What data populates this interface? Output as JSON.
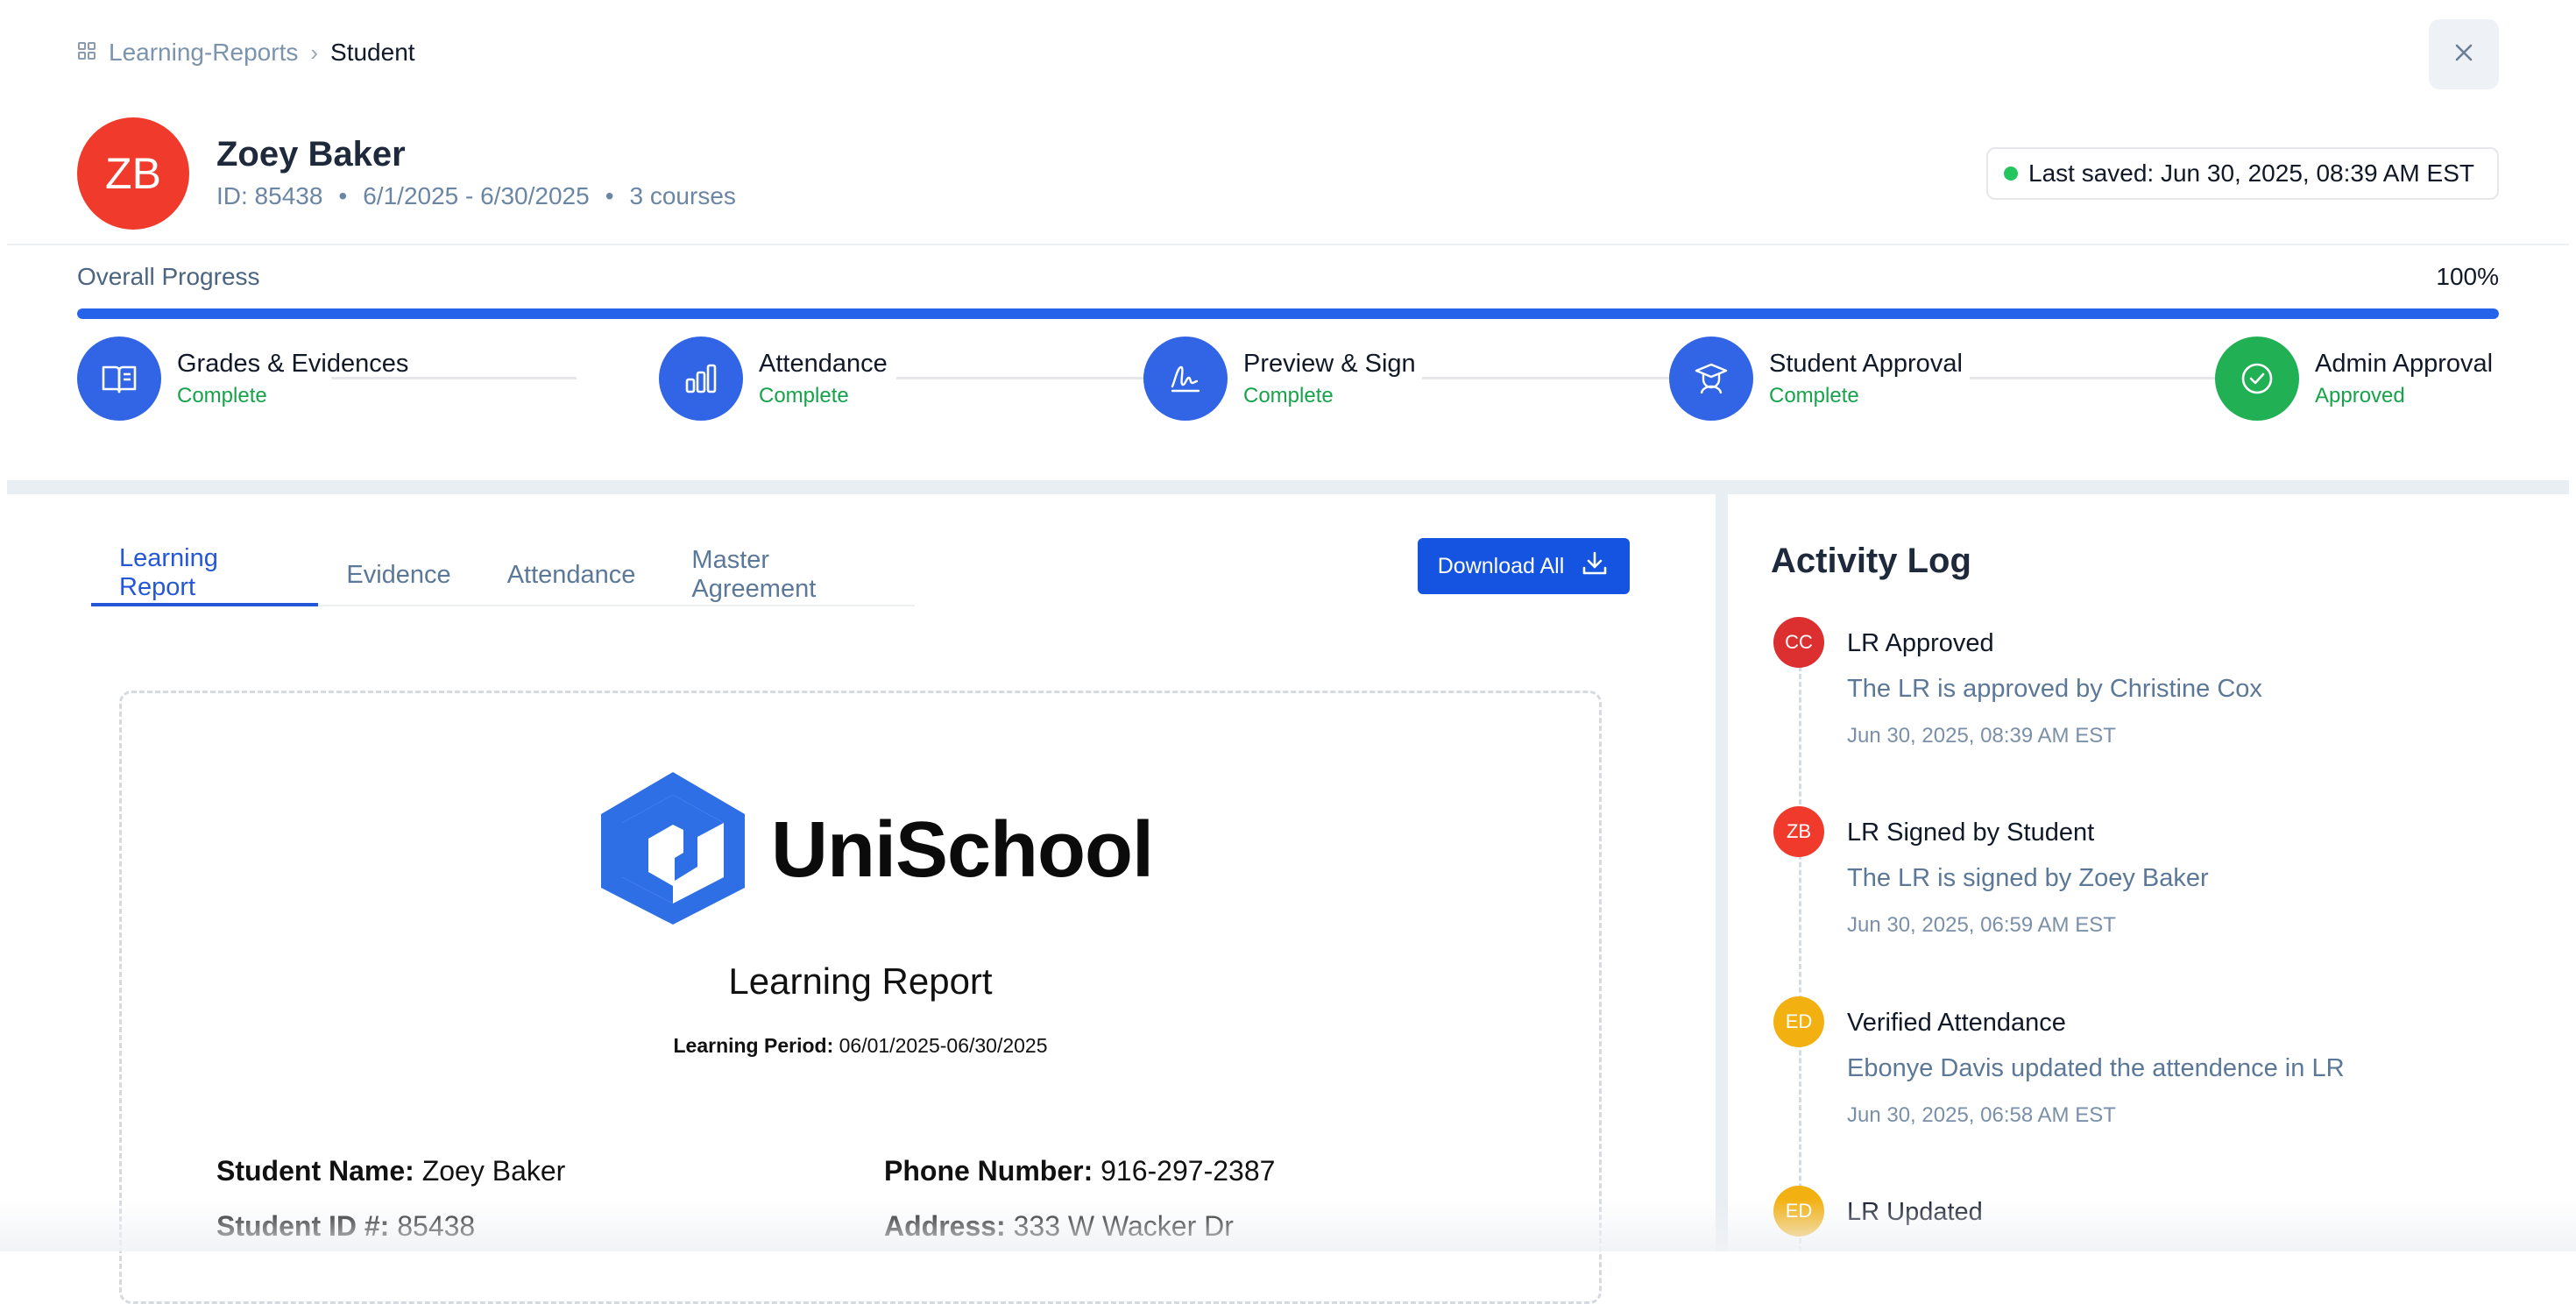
{
  "breadcrumb": {
    "root": "Learning-Reports",
    "current": "Student"
  },
  "student": {
    "initials": "ZB",
    "name": "Zoey Baker",
    "id_text": "ID: 85438",
    "period": "6/1/2025 - 6/30/2025",
    "courses": "3 courses",
    "dot": "•",
    "avatar_color": "#f03a2b"
  },
  "last_saved": "Last saved: Jun 30, 2025, 08:39 AM EST",
  "progress": {
    "label": "Overall Progress",
    "percent_text": "100%",
    "value": 1.0
  },
  "steps": [
    {
      "title": "Grades & Evidences",
      "status": "Complete",
      "icon": "book-open-icon"
    },
    {
      "title": "Attendance",
      "status": "Complete",
      "icon": "bar-chart-icon"
    },
    {
      "title": "Preview & Sign",
      "status": "Complete",
      "icon": "signature-icon"
    },
    {
      "title": "Student Approval",
      "status": "Complete",
      "icon": "graduate-icon"
    },
    {
      "title": "Admin Approval",
      "status": "Approved",
      "icon": "check-circle-icon"
    }
  ],
  "tabs": [
    "Learning Report",
    "Evidence",
    "Attendance",
    "Master Agreement"
  ],
  "download_label": "Download All",
  "report": {
    "brand": "UniSchool",
    "title": "Learning Report",
    "period_label": "Learning Period:",
    "period_value": "06/01/2025-06/30/2025",
    "fields": {
      "name_label": "Student Name:",
      "name_value": "Zoey Baker",
      "phone_label": "Phone Number:",
      "phone_value": "916-297-2387",
      "id_label": "Student ID #:",
      "id_value": "85438",
      "address_label": "Address:",
      "address_value": "333 W Wacker Dr"
    }
  },
  "activity": {
    "title": "Activity Log",
    "items": [
      {
        "initials": "CC",
        "color": "#dc2f2f",
        "title": "LR Approved",
        "desc": "The LR is approved by Christine Cox",
        "time": "Jun 30, 2025, 08:39 AM EST"
      },
      {
        "initials": "ZB",
        "color": "#f03a2b",
        "title": "LR Signed by Student",
        "desc": "The LR is signed by Zoey Baker",
        "time": "Jun 30, 2025, 06:59 AM EST"
      },
      {
        "initials": "ED",
        "color": "#f2b011",
        "title": "Verified Attendance",
        "desc": "Ebonye Davis updated the attendence in LR",
        "time": "Jun 30, 2025, 06:58 AM EST"
      },
      {
        "initials": "ED",
        "color": "#f2b011",
        "title": "LR Updated",
        "desc": "",
        "time": ""
      }
    ]
  },
  "colors": {
    "accent": "#2457d6",
    "step_blue": "#3165e5",
    "step_green": "#22b055",
    "status_green": "#16a34a"
  }
}
